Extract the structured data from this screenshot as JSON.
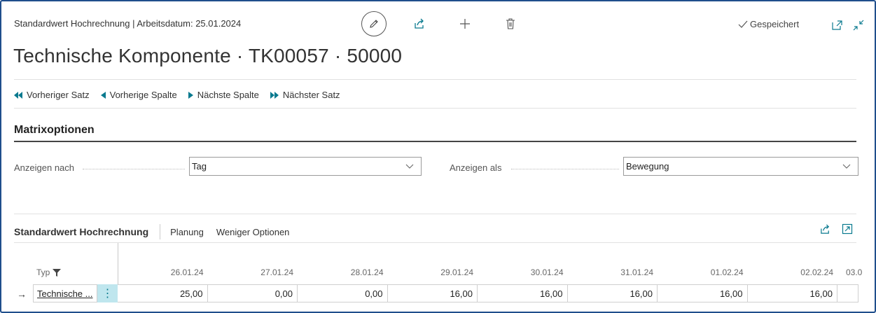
{
  "header": {
    "caption": "Standardwert Hochrechnung | Arbeitsdatum: 25.01.2024",
    "title": "Technische Komponente · TK00057 · 50000",
    "status": "Gespeichert"
  },
  "nav": {
    "prev_record": "Vorheriger Satz",
    "prev_column": "Vorherige Spalte",
    "next_column": "Nächste Spalte",
    "next_record": "Nächster Satz"
  },
  "matrix": {
    "title": "Matrixoptionen",
    "view_by_label": "Anzeigen nach",
    "view_by_value": "Tag",
    "view_as_label": "Anzeigen als",
    "view_as_value": "Bewegung"
  },
  "subpage": {
    "title": "Standardwert Hochrechnung",
    "action_planning": "Planung",
    "action_fewer": "Weniger Optionen",
    "typ_header": "Typ",
    "columns": [
      "26.01.24",
      "27.01.24",
      "28.01.24",
      "29.01.24",
      "30.01.24",
      "31.01.24",
      "01.02.24",
      "02.02.24",
      "03.0"
    ],
    "row": {
      "typ": "Technische ...",
      "values": [
        "25,00",
        "0,00",
        "0,00",
        "16,00",
        "16,00",
        "16,00",
        "16,00",
        "16,00",
        ""
      ]
    }
  },
  "colors": {
    "frame_border": "#1f4e8c",
    "accent_teal": "#0a7a8f",
    "selected_cell_bg": "#bfe6ee"
  },
  "icons": [
    "edit-icon",
    "share-icon",
    "plus-icon",
    "delete-icon",
    "checkmark-icon",
    "open-new-window-icon",
    "collapse-icon",
    "first-icon",
    "previous-icon",
    "next-icon",
    "last-icon",
    "chevron-down-icon",
    "filter-icon",
    "arrow-right-icon",
    "more-options-icon"
  ]
}
